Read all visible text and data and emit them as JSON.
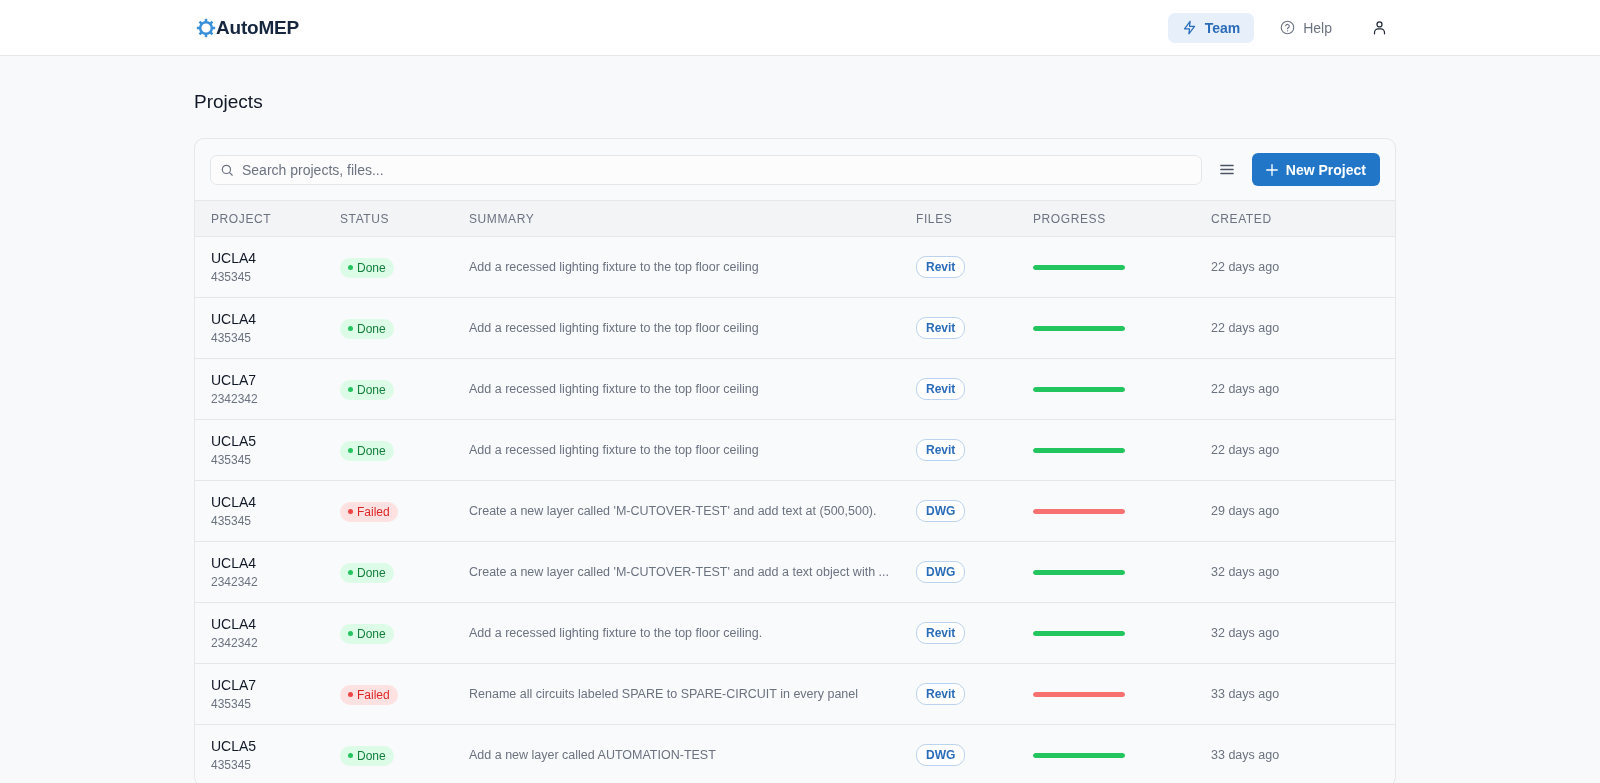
{
  "header": {
    "logo": "AutoMEP",
    "nav": [
      {
        "label": "Team",
        "selected": true
      },
      {
        "label": "Help",
        "selected": false
      }
    ]
  },
  "page": {
    "title": "Projects"
  },
  "toolbar": {
    "search": {
      "placeholder": "Search projects, files..."
    },
    "new_button": "New Project"
  },
  "table": {
    "columns": [
      "PROJECT",
      "STATUS",
      "SUMMARY",
      "FILES",
      "PROGRESS",
      "CREATED"
    ],
    "rows": [
      {
        "name": "UCLA4",
        "id": "435345",
        "status": {
          "kind": "done",
          "label": "Done"
        },
        "summary": "Add a recessed lighting fixture to the top floor ceiling",
        "file": "Revit",
        "progress": {
          "level": 1
        },
        "created": "22 days ago"
      },
      {
        "name": "UCLA4",
        "id": "435345",
        "status": {
          "kind": "done",
          "label": "Done"
        },
        "summary": "Add a recessed lighting fixture to the top floor ceiling",
        "file": "Revit",
        "progress": {
          "level": 1
        },
        "created": "22 days ago"
      },
      {
        "name": "UCLA7",
        "id": "2342342",
        "status": {
          "kind": "done",
          "label": "Done"
        },
        "summary": "Add a recessed lighting fixture to the top floor ceiling",
        "file": "Revit",
        "progress": {
          "level": 1
        },
        "created": "22 days ago"
      },
      {
        "name": "UCLA5",
        "id": "435345",
        "status": {
          "kind": "done",
          "label": "Done"
        },
        "summary": "Add a recessed lighting fixture to the top floor ceiling",
        "file": "Revit",
        "progress": {
          "level": 1
        },
        "created": "22 days ago"
      },
      {
        "name": "UCLA4",
        "id": "435345",
        "status": {
          "kind": "failed",
          "label": "Failed"
        },
        "summary": "Create a new layer called 'M-CUTOVER-TEST' and add text at (500,500).",
        "file": "DWG",
        "progress": {
          "level": 1
        },
        "created": "29 days ago"
      },
      {
        "name": "UCLA4",
        "id": "2342342",
        "status": {
          "kind": "done",
          "label": "Done"
        },
        "summary": "Create a new layer called 'M-CUTOVER-TEST' and add a text object with ...",
        "file": "DWG",
        "progress": {
          "level": 1
        },
        "created": "32 days ago"
      },
      {
        "name": "UCLA4",
        "id": "2342342",
        "status": {
          "kind": "done",
          "label": "Done"
        },
        "summary": "Add a recessed lighting fixture to the top floor ceiling.",
        "file": "Revit",
        "progress": {
          "level": 1
        },
        "created": "32 days ago"
      },
      {
        "name": "UCLA7",
        "id": "435345",
        "status": {
          "kind": "failed",
          "label": "Failed"
        },
        "summary": "Rename all circuits labeled SPARE to SPARE-CIRCUIT in every panel",
        "file": "Revit",
        "progress": {
          "level": 1
        },
        "created": "33 days ago"
      },
      {
        "name": "UCLA5",
        "id": "435345",
        "status": {
          "kind": "done",
          "label": "Done"
        },
        "summary": "Add a new layer called AUTOMATION-TEST",
        "file": "DWG",
        "progress": {
          "level": 1
        },
        "created": "33 days ago"
      }
    ]
  }
}
